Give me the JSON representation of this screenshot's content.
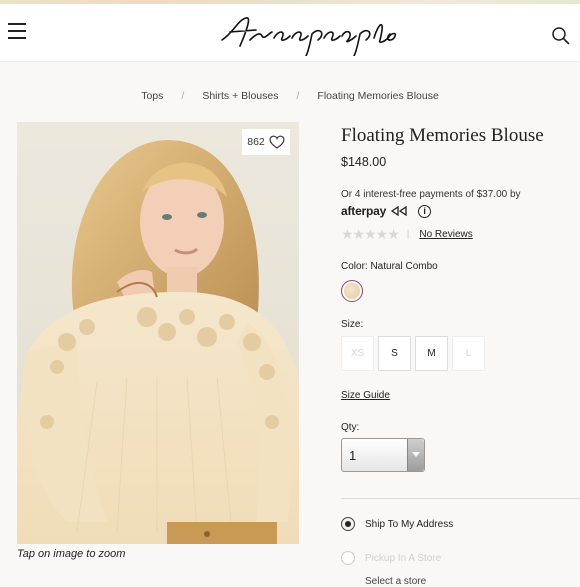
{
  "header": {
    "logo_text": "free people",
    "menu_icon": "hamburger-menu-icon",
    "search_icon": "search-icon"
  },
  "breadcrumb": [
    "Tops",
    "Shirts + Blouses",
    "Floating Memories Blouse"
  ],
  "gallery": {
    "like_count": "862",
    "zoom_caption": "Tap on image to zoom"
  },
  "product": {
    "title": "Floating Memories Blouse",
    "price": "$148.00",
    "afterpay_text": "Or 4 interest-free payments of $37.00 by",
    "afterpay_logo": "afterpay",
    "rating_stars": 0,
    "reviews_link": "No Reviews",
    "color_label": "Color: Natural Combo",
    "size_label": "Size:",
    "sizes": [
      {
        "label": "XS",
        "available": false
      },
      {
        "label": "S",
        "available": true
      },
      {
        "label": "M",
        "available": true
      },
      {
        "label": "L",
        "available": false
      }
    ],
    "size_guide": "Size Guide",
    "qty_label": "Qty:",
    "qty_value": "1"
  },
  "shipping": {
    "options": [
      {
        "label": "Ship To My Address",
        "selected": true,
        "enabled": true
      },
      {
        "label": "Pickup In A Store",
        "selected": false,
        "enabled": false
      }
    ],
    "cutoff_text": "Select a store"
  },
  "colors": {
    "accent_swatch_ring": "#8a4a6a",
    "background": "#faf8f6"
  }
}
